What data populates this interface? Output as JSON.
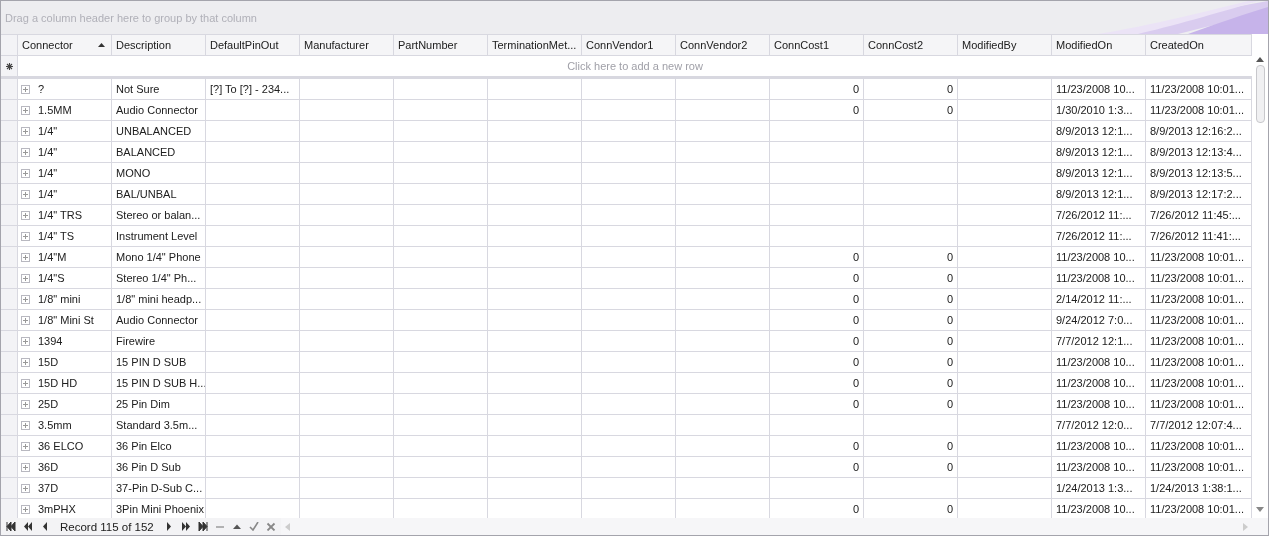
{
  "group_panel": {
    "placeholder": "Drag a column header here to group by that column"
  },
  "table": {
    "columns": [
      {
        "label": "Connector",
        "sorted": true
      },
      {
        "label": "Description",
        "sorted": false
      },
      {
        "label": "DefaultPinOut",
        "sorted": false
      },
      {
        "label": "Manufacturer",
        "sorted": false
      },
      {
        "label": "PartNumber",
        "sorted": false
      },
      {
        "label": "TerminationMet...",
        "sorted": false
      },
      {
        "label": "ConnVendor1",
        "sorted": false
      },
      {
        "label": "ConnVendor2",
        "sorted": false
      },
      {
        "label": "ConnCost1",
        "sorted": false
      },
      {
        "label": "ConnCost2",
        "sorted": false
      },
      {
        "label": "ModifiedBy",
        "sorted": false
      },
      {
        "label": "ModifiedOn",
        "sorted": false
      },
      {
        "label": "CreatedOn",
        "sorted": false
      }
    ],
    "new_row": {
      "prompt": "Click here to add a new row"
    },
    "rows": [
      {
        "connector": "?",
        "description": "Not Sure",
        "default_pin_out": "[?] To [?] - 234...",
        "conn_cost1": "0",
        "conn_cost2": "0",
        "modified_on": "11/23/2008 10...",
        "created_on": "11/23/2008 10:01..."
      },
      {
        "connector": "1.5MM",
        "description": "Audio Connector",
        "conn_cost1": "0",
        "conn_cost2": "0",
        "modified_on": "1/30/2010 1:3...",
        "created_on": "11/23/2008 10:01..."
      },
      {
        "connector": "1/4\"",
        "description": "UNBALANCED",
        "modified_on": "8/9/2013 12:1...",
        "created_on": "8/9/2013 12:16:2..."
      },
      {
        "connector": "1/4\"",
        "description": "BALANCED",
        "modified_on": "8/9/2013 12:1...",
        "created_on": "8/9/2013 12:13:4..."
      },
      {
        "connector": "1/4\"",
        "description": "MONO",
        "modified_on": "8/9/2013 12:1...",
        "created_on": "8/9/2013 12:13:5..."
      },
      {
        "connector": "1/4\"",
        "description": "BAL/UNBAL",
        "modified_on": "8/9/2013 12:1...",
        "created_on": "8/9/2013 12:17:2..."
      },
      {
        "connector": "1/4\" TRS",
        "description": "Stereo or balan...",
        "modified_on": "7/26/2012 11:...",
        "created_on": "7/26/2012 11:45:..."
      },
      {
        "connector": "1/4\" TS",
        "description": "Instrument Level",
        "modified_on": "7/26/2012 11:...",
        "created_on": "7/26/2012 11:41:..."
      },
      {
        "connector": "1/4\"M",
        "description": "Mono 1/4\" Phone",
        "conn_cost1": "0",
        "conn_cost2": "0",
        "modified_on": "11/23/2008 10...",
        "created_on": "11/23/2008 10:01..."
      },
      {
        "connector": "1/4\"S",
        "description": "Stereo 1/4\" Ph...",
        "conn_cost1": "0",
        "conn_cost2": "0",
        "modified_on": "11/23/2008 10...",
        "created_on": "11/23/2008 10:01..."
      },
      {
        "connector": "1/8\" mini",
        "description": "1/8\" mini headp...",
        "conn_cost1": "0",
        "conn_cost2": "0",
        "modified_on": "2/14/2012 11:...",
        "created_on": "11/23/2008 10:01..."
      },
      {
        "connector": "1/8\" Mini St",
        "description": "Audio Connector",
        "conn_cost1": "0",
        "conn_cost2": "0",
        "modified_on": "9/24/2012 7:0...",
        "created_on": "11/23/2008 10:01..."
      },
      {
        "connector": "1394",
        "description": "Firewire",
        "conn_cost1": "0",
        "conn_cost2": "0",
        "modified_on": "7/7/2012 12:1...",
        "created_on": "11/23/2008 10:01..."
      },
      {
        "connector": "15D",
        "description": "15 PIN D SUB",
        "conn_cost1": "0",
        "conn_cost2": "0",
        "modified_on": "11/23/2008 10...",
        "created_on": "11/23/2008 10:01..."
      },
      {
        "connector": "15D HD",
        "description": "15 PIN D SUB H...",
        "conn_cost1": "0",
        "conn_cost2": "0",
        "modified_on": "11/23/2008 10...",
        "created_on": "11/23/2008 10:01..."
      },
      {
        "connector": "25D",
        "description": "25 Pin Dim",
        "conn_cost1": "0",
        "conn_cost2": "0",
        "modified_on": "11/23/2008 10...",
        "created_on": "11/23/2008 10:01..."
      },
      {
        "connector": "3.5mm",
        "description": "Standard 3.5m...",
        "modified_on": "7/7/2012 12:0...",
        "created_on": "7/7/2012 12:07:4..."
      },
      {
        "connector": "36 ELCO",
        "description": "36 Pin Elco",
        "conn_cost1": "0",
        "conn_cost2": "0",
        "modified_on": "11/23/2008 10...",
        "created_on": "11/23/2008 10:01..."
      },
      {
        "connector": "36D",
        "description": "36 Pin D Sub",
        "conn_cost1": "0",
        "conn_cost2": "0",
        "modified_on": "11/23/2008 10...",
        "created_on": "11/23/2008 10:01..."
      },
      {
        "connector": "37D",
        "description": "37-Pin D-Sub C...",
        "modified_on": "1/24/2013 1:3...",
        "created_on": "1/24/2013 1:38:1..."
      },
      {
        "connector": "3mPHX",
        "description": "3Pin Mini Phoenix",
        "conn_cost1": "0",
        "conn_cost2": "0",
        "modified_on": "11/23/2008 10...",
        "created_on": "11/23/2008 10:01..."
      }
    ]
  },
  "navigator": {
    "record_text": "Record 115 of 152"
  }
}
